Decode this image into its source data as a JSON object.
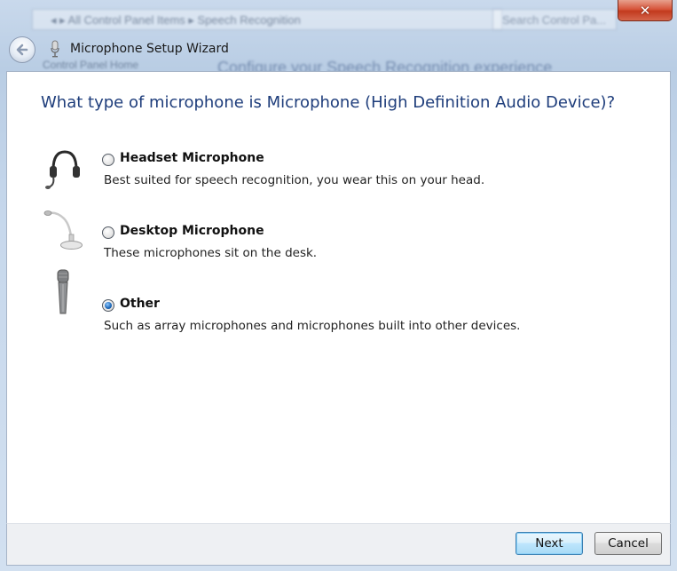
{
  "window": {
    "title": "Microphone Setup Wizard",
    "close_symbol": "✕",
    "background": {
      "address_text": "◂ ▸  All Control Panel Items  ▸  Speech Recognition",
      "search_placeholder": "Search Control Pa...",
      "left_link": "Control Panel Home",
      "heading": "Configure your Speech Recognition experience"
    }
  },
  "wizard": {
    "question": "What type of microphone is Microphone (High Definition Audio Device)?",
    "options": [
      {
        "label": "Headset Microphone",
        "description": "Best suited for speech recognition, you wear this on your head.",
        "icon": "headset-icon",
        "checked": false
      },
      {
        "label": "Desktop Microphone",
        "description": "These microphones sit on the desk.",
        "icon": "desktop-microphone-icon",
        "checked": false
      },
      {
        "label": "Other",
        "description": "Such as array microphones and microphones built into other devices.",
        "icon": "handheld-microphone-icon",
        "checked": true
      }
    ]
  },
  "footer": {
    "next_label": "Next",
    "cancel_label": "Cancel"
  },
  "colors": {
    "question_text": "#1e3d7b",
    "close_button": "#c23a1e",
    "radio_selected": "#1b65b5"
  }
}
